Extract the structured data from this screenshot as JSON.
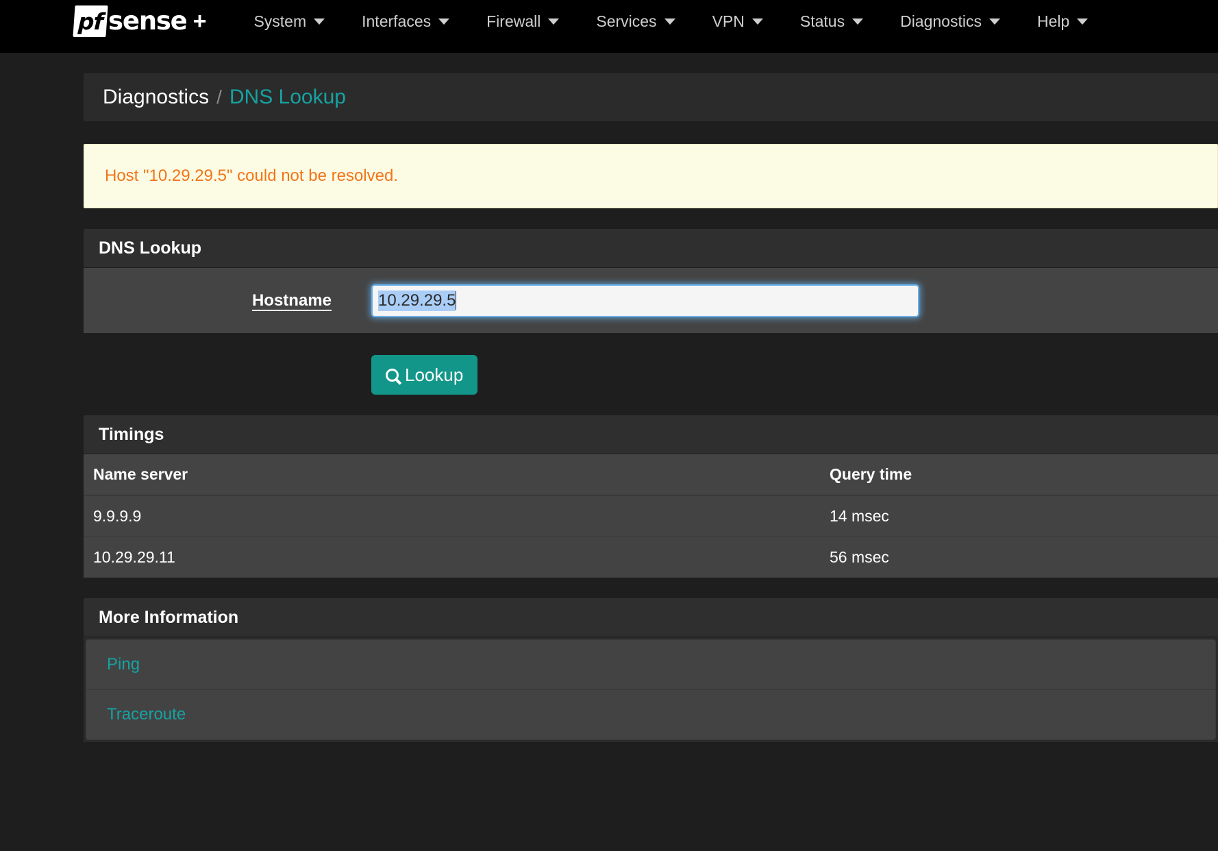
{
  "navbar": {
    "brand": {
      "mark": "pf",
      "text": "sense",
      "plus": "+"
    },
    "items": [
      {
        "label": "System",
        "icon": "chevron-down-icon"
      },
      {
        "label": "Interfaces",
        "icon": "chevron-down-icon"
      },
      {
        "label": "Firewall",
        "icon": "chevron-down-icon"
      },
      {
        "label": "Services",
        "icon": "chevron-down-icon"
      },
      {
        "label": "VPN",
        "icon": "chevron-down-icon"
      },
      {
        "label": "Status",
        "icon": "chevron-down-icon"
      },
      {
        "label": "Diagnostics",
        "icon": "chevron-down-icon"
      },
      {
        "label": "Help",
        "icon": "chevron-down-icon"
      }
    ]
  },
  "breadcrumb": {
    "root": "Diagnostics",
    "separator": "/",
    "active": "DNS Lookup"
  },
  "alert": {
    "message": "Host \"10.29.29.5\" could not be resolved."
  },
  "dns_lookup_panel": {
    "title": "DNS Lookup",
    "hostname_label": "Hostname",
    "hostname_value": "10.29.29.5",
    "hostname_placeholder": "",
    "lookup_button": "Lookup",
    "lookup_icon": "search-icon"
  },
  "timings_panel": {
    "title": "Timings",
    "columns": [
      "Name server",
      "Query time"
    ],
    "rows": [
      {
        "name_server": "9.9.9.9",
        "query_time": "14 msec"
      },
      {
        "name_server": "10.29.29.11",
        "query_time": "56 msec"
      }
    ]
  },
  "more_information_panel": {
    "title": "More Information",
    "links": [
      {
        "label": "Ping"
      },
      {
        "label": "Traceroute"
      }
    ]
  },
  "colors": {
    "navbar_bg": "#000000",
    "page_bg": "#1e1e1e",
    "panel_heading_bg": "#2f2f2f",
    "panel_body_bg": "#444444",
    "accent_teal": "#17a2a2",
    "button_teal": "#13968a",
    "alert_bg": "#fcfbe3",
    "alert_text": "#f2751a",
    "focus_blue": "#66afe9",
    "selection_blue": "#aacdf7"
  }
}
